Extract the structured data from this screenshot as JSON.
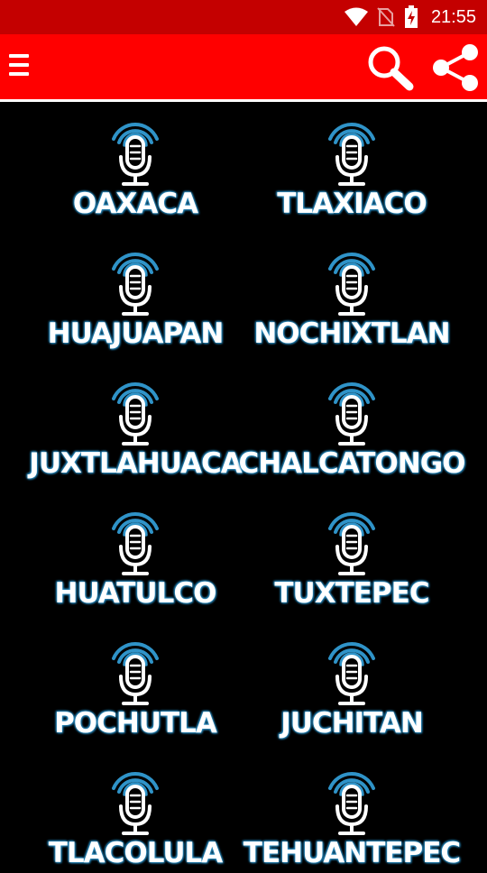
{
  "status_bar": {
    "time": "21:55",
    "icons": [
      "wifi-icon",
      "no-sim-icon",
      "battery-charging-icon"
    ]
  },
  "app_bar": {
    "icons": [
      "menu-icon",
      "search-icon",
      "share-icon"
    ],
    "color": "#ff0000"
  },
  "colors": {
    "status_bar": "#c40000",
    "background": "#000000",
    "signal_blue": "#2f93c8"
  },
  "stations": [
    {
      "name": "OAXACA"
    },
    {
      "name": "TLAXIACO"
    },
    {
      "name": "HUAJUAPAN"
    },
    {
      "name": "NOCHIXTLAN"
    },
    {
      "name": "JUXTLAHUACA"
    },
    {
      "name": "CHALCATONGO"
    },
    {
      "name": "HUATULCO"
    },
    {
      "name": "TUXTEPEC"
    },
    {
      "name": "POCHUTLA"
    },
    {
      "name": "JUCHITAN"
    },
    {
      "name": "TLACOLULA"
    },
    {
      "name": "TEHUANTEPEC"
    }
  ]
}
